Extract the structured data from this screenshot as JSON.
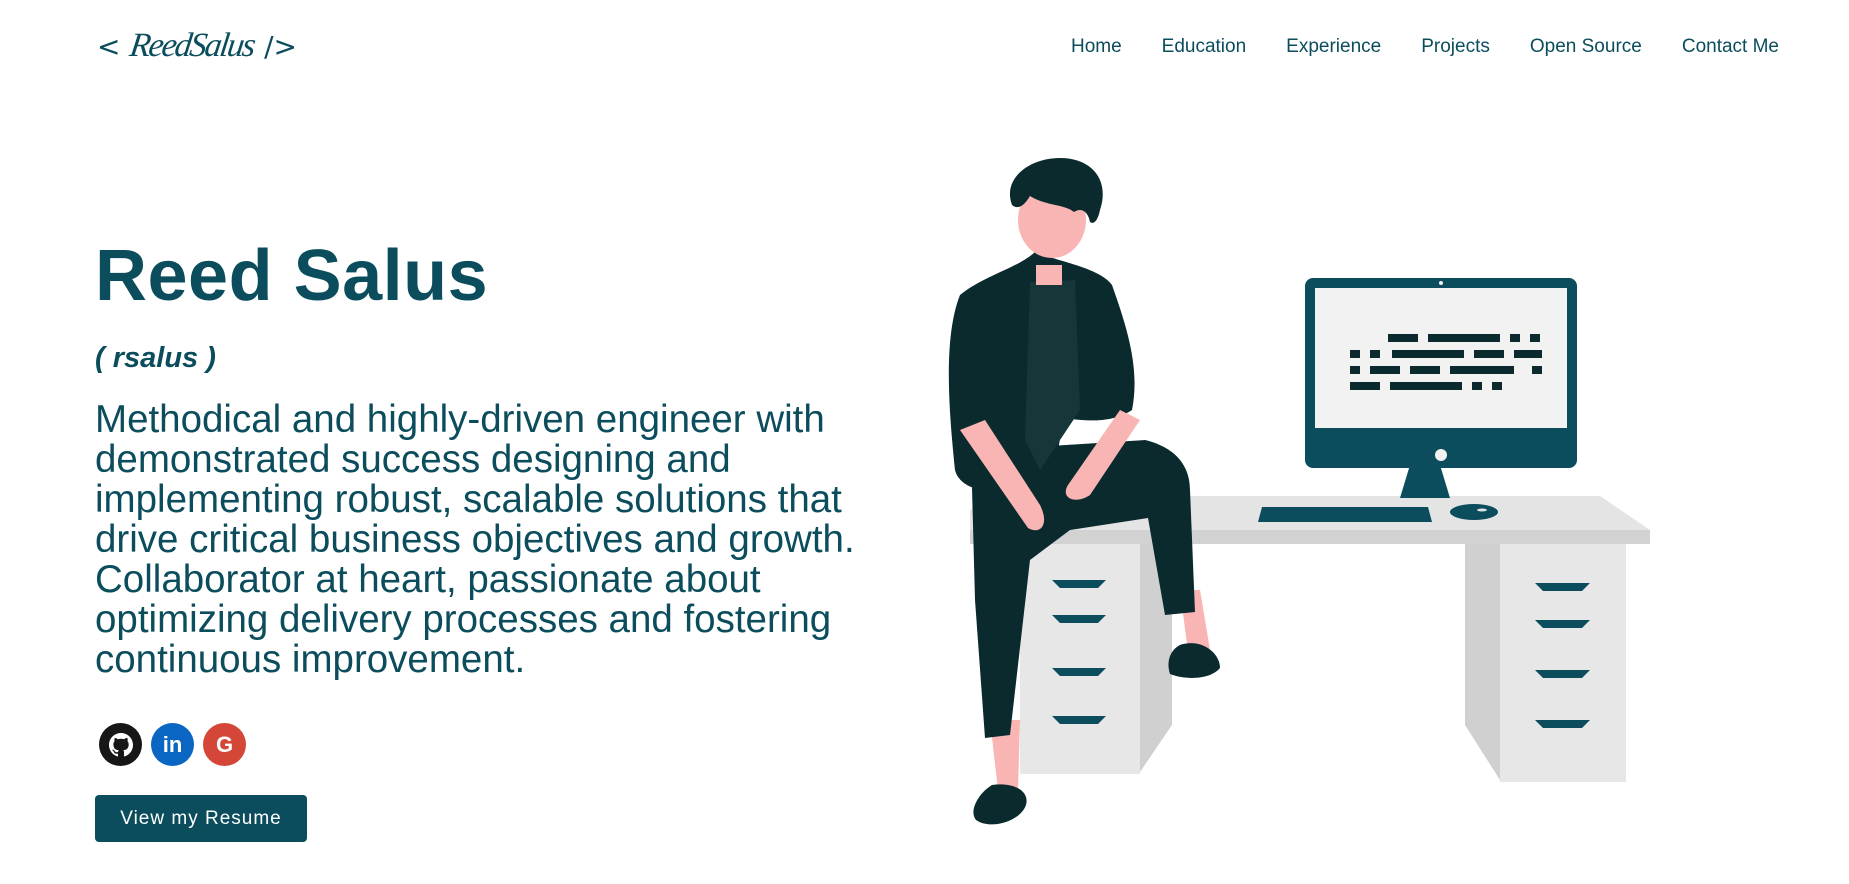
{
  "header": {
    "logo": {
      "open": "<",
      "name": "ReedSalus",
      "close": "/>"
    },
    "nav": [
      "Home",
      "Education",
      "Experience",
      "Projects",
      "Open Source",
      "Contact Me"
    ]
  },
  "hero": {
    "name": "Reed Salus",
    "username": "( rsalus )",
    "description": "Methodical and highly-driven engineer with demonstrated success designing and implementing robust, scalable solutions that drive critical business objectives and growth. Collaborator at heart, passionate about optimizing delivery processes and fostering continuous improvement.",
    "socials": [
      {
        "name": "github",
        "icon": "github-icon",
        "color": "#181717"
      },
      {
        "name": "linkedin",
        "icon": "linkedin-icon",
        "label": "in",
        "color": "#0a66c2"
      },
      {
        "name": "google",
        "icon": "google-icon",
        "label": "G",
        "color": "#d44638"
      }
    ],
    "resume_button": "View my Resume"
  },
  "colors": {
    "primary": "#0b4d5c",
    "dark": "#0a2a2e",
    "skin": "#f9b5b3",
    "desk": "#e4e4e4"
  }
}
